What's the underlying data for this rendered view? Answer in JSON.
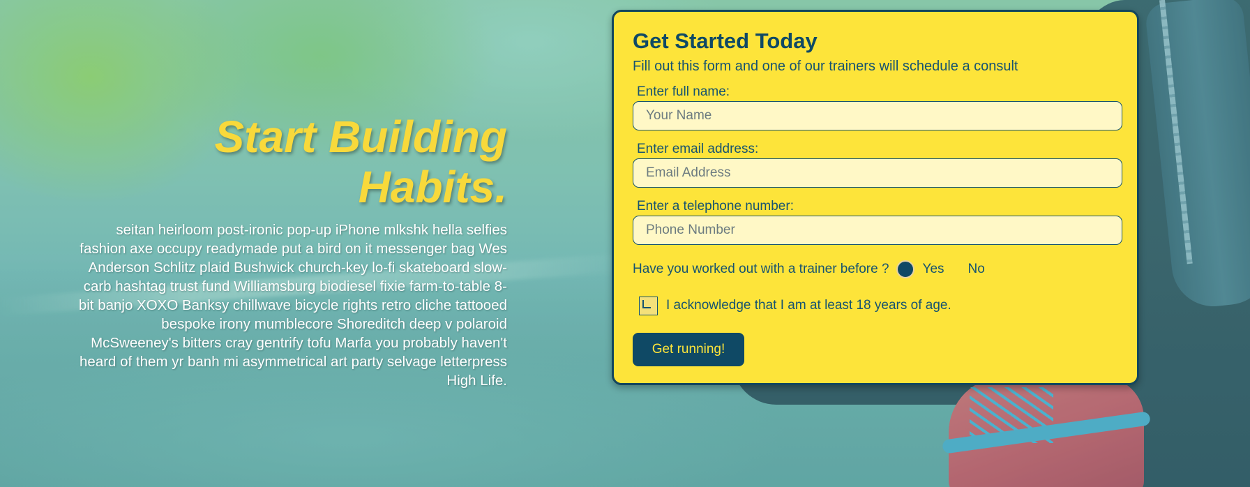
{
  "hero": {
    "title_line1": "Start Building",
    "title_line2": "Habits.",
    "body": "seitan heirloom post-ironic pop-up iPhone mlkshk hella selfies fashion axe occupy readymade put a bird on it messenger bag Wes Anderson Schlitz plaid Bushwick church-key lo-fi skateboard slow-carb hashtag trust fund Williamsburg biodiesel fixie farm-to-table 8-bit banjo XOXO Banksy chillwave bicycle rights retro cliche tattooed bespoke irony mumblecore Shoreditch deep v polaroid McSweeney's bitters cray gentrify tofu Marfa you probably haven't heard of them yr banh mi asymmetrical art party selvage letterpress High Life."
  },
  "form": {
    "title": "Get Started Today",
    "subtitle": "Fill out this form and one of our trainers will schedule a consult",
    "name": {
      "label": "Enter full name:",
      "placeholder": "Your Name",
      "value": ""
    },
    "email": {
      "label": "Enter email address:",
      "placeholder": "Email Address",
      "value": ""
    },
    "phone": {
      "label": "Enter a telephone number:",
      "placeholder": "Phone Number",
      "value": ""
    },
    "trainer_question": {
      "label": "Have you worked out with a trainer before ?",
      "options": [
        "Yes",
        "No"
      ],
      "selected": ""
    },
    "age_ack": {
      "label": "I acknowledge that I am at least 18 years of age.",
      "checked": false
    },
    "submit_label": "Get running!"
  },
  "colors": {
    "accent_yellow": "#fde43a",
    "hero_yellow": "#f8d93b",
    "navy": "#0f4965",
    "input_bg": "#fff8c6"
  },
  "icons": [
    "radio-button-icon",
    "checkbox-icon"
  ]
}
